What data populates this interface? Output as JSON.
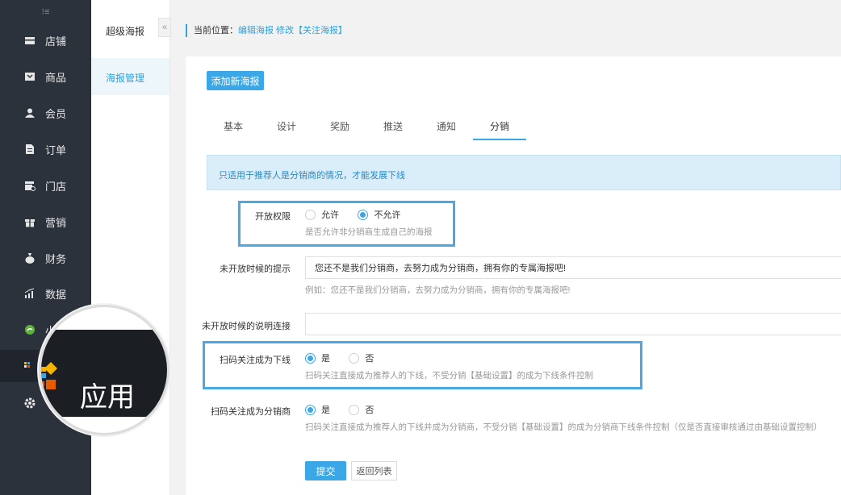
{
  "sidebar": {
    "toggle_glyph": "⁝≡",
    "items": [
      {
        "label": "店铺",
        "icon": "store-icon"
      },
      {
        "label": "商品",
        "icon": "goods-icon"
      },
      {
        "label": "会员",
        "icon": "member-icon"
      },
      {
        "label": "订单",
        "icon": "order-icon"
      },
      {
        "label": "门店",
        "icon": "shop-icon"
      },
      {
        "label": "营销",
        "icon": "gift-icon"
      },
      {
        "label": "财务",
        "icon": "money-bag-icon"
      },
      {
        "label": "数据",
        "icon": "chart-icon"
      },
      {
        "label": "小程",
        "icon": "miniprogram-icon"
      },
      {
        "label": "应用",
        "icon": "apps-icon"
      },
      {
        "label": "",
        "icon": "gear-icon"
      }
    ],
    "magnified_label": "应用"
  },
  "subnav": {
    "title": "超级海报",
    "active_item": "海报管理",
    "collapse_glyph": "«"
  },
  "breadcrumb": {
    "prefix": "当前位置：",
    "path": "编辑海报 修改【关注海报】"
  },
  "main": {
    "add_button": "添加新海报",
    "tabs": [
      {
        "label": "基本"
      },
      {
        "label": "设计"
      },
      {
        "label": "奖励"
      },
      {
        "label": "推送"
      },
      {
        "label": "通知"
      },
      {
        "label": "分销",
        "active": true
      }
    ],
    "notice": "只适用于推荐人是分销商的情况，才能发展下线",
    "form": {
      "open_permission": {
        "label": "开放权限",
        "options": [
          "允许",
          "不允许"
        ],
        "selected": "不允许",
        "help": "是否允许非分销商生成自己的海报"
      },
      "closed_tip": {
        "label": "未开放时候的提示",
        "value": "您还不是我们分销商，去努力成为分销商，拥有你的专属海报吧!",
        "help": "例如：您还不是我们分销商，去努力成为分销商，拥有你的专属海报吧!"
      },
      "closed_link": {
        "label": "未开放时候的说明连接",
        "value": ""
      },
      "scan_downline": {
        "label": "扫码关注成为下线",
        "options": [
          "是",
          "否"
        ],
        "selected": "是",
        "help": "扫码关注直接成为推荐人的下线，不受分销【基础设置】的成为下线条件控制"
      },
      "scan_distributor": {
        "label": "扫码关注成为分销商",
        "options": [
          "是",
          "否"
        ],
        "selected": "是",
        "help": "扫码关注直接成为推荐人的下线并成为分销商，不受分销【基础设置】的成为分销商下线条件控制（仅是否直接审核通过由基础设置控制）"
      }
    },
    "submit_button": "提交",
    "back_button": "返回列表"
  },
  "colors": {
    "accent": "#3ba7e6",
    "sidebar_bg": "#2b323c",
    "highlight_border": "#4aa9e3"
  }
}
